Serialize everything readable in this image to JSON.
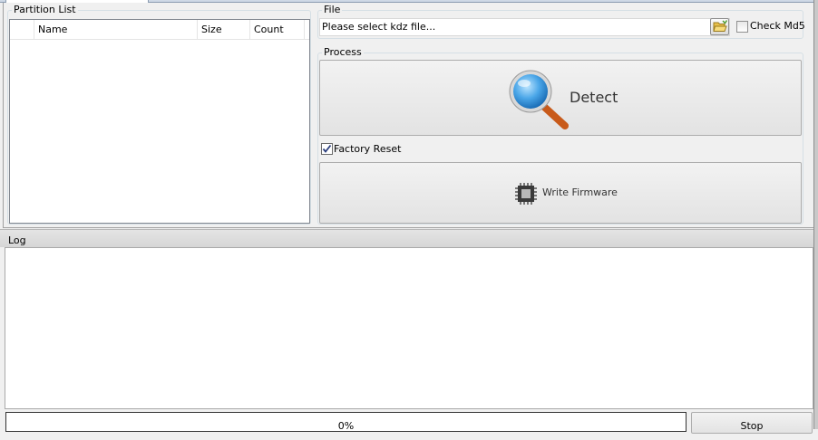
{
  "partition_list": {
    "title": "Partition List",
    "columns": [
      "Name",
      "Size",
      "Count"
    ]
  },
  "file": {
    "title": "File",
    "input_value": "Please select kdz file...",
    "browse_icon": "folder-open-icon",
    "check_md5_label": "Check Md5",
    "check_md5_checked": false
  },
  "process": {
    "title": "Process",
    "detect_label": "Detect",
    "detect_icon": "magnifier-icon",
    "factory_reset_label": "Factory Reset",
    "factory_reset_checked": true,
    "write_firmware_label": "Write Firmware",
    "write_firmware_icon": "chip-icon"
  },
  "log": {
    "title": "Log"
  },
  "progress": {
    "value": 0,
    "text": "0%"
  },
  "stop_label": "Stop",
  "colors": {
    "window_bg": "#f0f0f0",
    "accent_border": "#d5dfe5",
    "progress_fill": "#06b025"
  }
}
